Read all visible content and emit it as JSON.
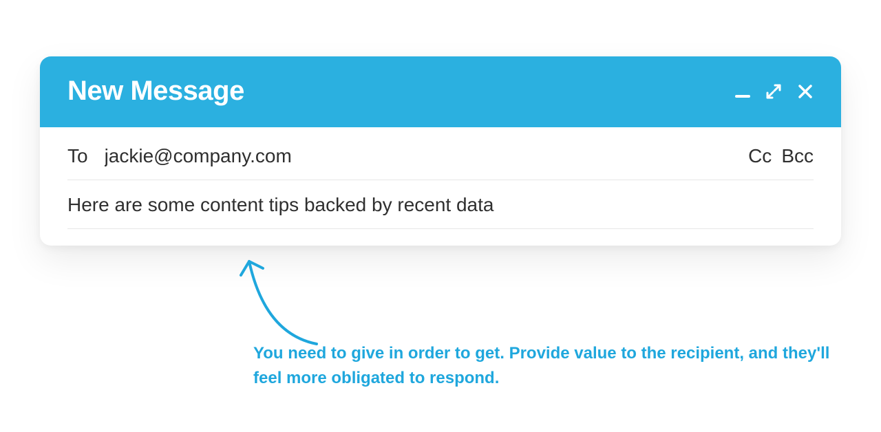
{
  "header": {
    "title": "New Message"
  },
  "to": {
    "label": "To",
    "value": "jackie@company.com",
    "cc_label": "Cc",
    "bcc_label": "Bcc"
  },
  "subject": {
    "value": "Here are some content tips backed by recent data"
  },
  "annotation": {
    "text": "You need to give in order to get. Provide value to the recipient, and they'll feel more obligated to respond."
  },
  "colors": {
    "accent": "#2bb0e0"
  }
}
